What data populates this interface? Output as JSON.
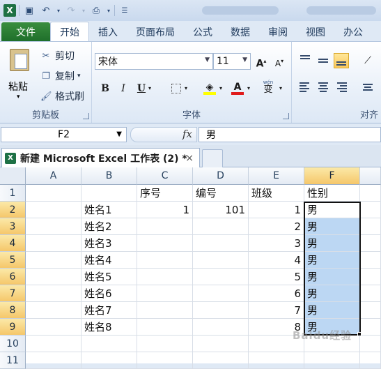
{
  "quick_access": {
    "app_icon": "X"
  },
  "tabs": [
    {
      "label": "文件"
    },
    {
      "label": "开始"
    },
    {
      "label": "插入"
    },
    {
      "label": "页面布局"
    },
    {
      "label": "公式"
    },
    {
      "label": "数据"
    },
    {
      "label": "审阅"
    },
    {
      "label": "视图"
    },
    {
      "label": "办公"
    }
  ],
  "ribbon": {
    "clipboard": {
      "paste": "粘贴",
      "cut": "剪切",
      "copy": "复制",
      "format_painter": "格式刷",
      "group_label": "剪贴板"
    },
    "font": {
      "font_name": "宋体",
      "font_size": "11",
      "bold": "B",
      "italic": "I",
      "underline": "U",
      "grow": "A",
      "shrink": "A",
      "font_color_letter": "A",
      "phonetic": "wén",
      "phonetic_char": "变",
      "group_label": "字体"
    },
    "alignment": {
      "group_label": "对齐"
    }
  },
  "formula_bar": {
    "name_box": "F2",
    "fx": "fx",
    "value": "男"
  },
  "workbook": {
    "tab_title": "新建 Microsoft Excel 工作表 (2) *",
    "close": "×"
  },
  "sheet": {
    "columns": [
      "A",
      "B",
      "C",
      "D",
      "E",
      "F"
    ],
    "rows": [
      "1",
      "2",
      "3",
      "4",
      "5",
      "6",
      "7",
      "8",
      "9",
      "10",
      "11"
    ],
    "cells": {
      "C1": "序号",
      "D1": "编号",
      "E1": "班级",
      "F1": "性别",
      "B2": "姓名1",
      "C2": "1",
      "D2": "101",
      "E2": "1",
      "F2": "男",
      "B3": "姓名2",
      "E3": "2",
      "F3": "男",
      "B4": "姓名3",
      "E4": "3",
      "F4": "男",
      "B5": "姓名4",
      "E5": "4",
      "F5": "男",
      "B6": "姓名5",
      "E6": "5",
      "F6": "男",
      "B7": "姓名6",
      "E7": "6",
      "F7": "男",
      "B8": "姓名7",
      "E8": "7",
      "F8": "男",
      "B9": "姓名8",
      "E9": "8",
      "F9": "男"
    },
    "selected_column": "F",
    "selection": "F2:F9"
  },
  "watermark": "Baidu经验",
  "colors": {
    "file_tab": "#2a7d33",
    "selection_fill": "#bcd7f3",
    "header_selected": "#f5c76a"
  }
}
